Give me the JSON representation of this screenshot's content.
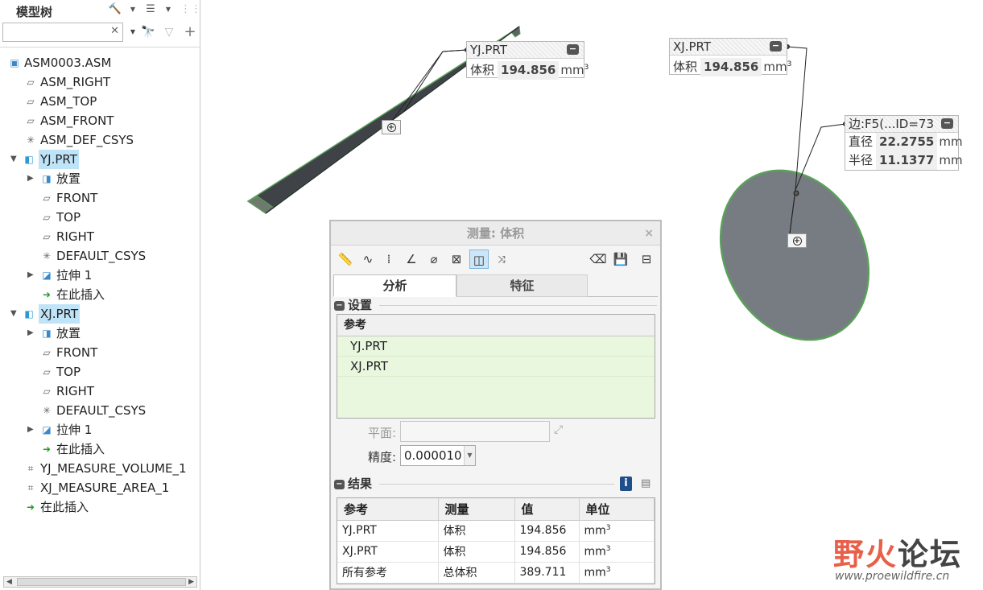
{
  "tree": {
    "title": "模型树",
    "search_value": "",
    "rows": [
      {
        "label": "ASM0003.ASM"
      },
      {
        "label": "ASM_RIGHT"
      },
      {
        "label": "ASM_TOP"
      },
      {
        "label": "ASM_FRONT"
      },
      {
        "label": "ASM_DEF_CSYS"
      },
      {
        "label": "YJ.PRT"
      },
      {
        "label": "放置"
      },
      {
        "label": "FRONT"
      },
      {
        "label": "TOP"
      },
      {
        "label": "RIGHT"
      },
      {
        "label": "DEFAULT_CSYS"
      },
      {
        "label": "拉伸 1"
      },
      {
        "label": "在此插入"
      },
      {
        "label": "XJ.PRT"
      },
      {
        "label": "放置"
      },
      {
        "label": "FRONT"
      },
      {
        "label": "TOP"
      },
      {
        "label": "RIGHT"
      },
      {
        "label": "DEFAULT_CSYS"
      },
      {
        "label": "拉伸 1"
      },
      {
        "label": "在此插入"
      },
      {
        "label": "YJ_MEASURE_VOLUME_1"
      },
      {
        "label": "XJ_MEASURE_AREA_1"
      },
      {
        "label": "在此插入"
      }
    ]
  },
  "callouts": {
    "yj": {
      "title": "YJ.PRT",
      "key": "体积",
      "value": "194.856",
      "unit": "mm",
      "unit_sup": "3"
    },
    "xj": {
      "title": "XJ.PRT",
      "key": "体积",
      "value": "194.856",
      "unit": "mm",
      "unit_sup": "3"
    },
    "edge": {
      "title": "边:F5(...ID=73",
      "rows": [
        {
          "key": "直径",
          "value": "22.2755",
          "unit": "mm"
        },
        {
          "key": "半径",
          "value": "11.1377",
          "unit": "mm"
        }
      ]
    }
  },
  "dialog": {
    "title": "测量: 体积",
    "close": "×",
    "tabs": [
      {
        "label": "分析"
      },
      {
        "label": "特征"
      }
    ],
    "settings_label": "设置",
    "ref_header": "参考",
    "refs": [
      "YJ.PRT",
      "XJ.PRT"
    ],
    "plane_label": "平面:",
    "plane_value": "",
    "precision_label": "精度:",
    "precision_value": "0.000010",
    "results_label": "结果",
    "results_headers": [
      "参考",
      "测量",
      "值",
      "单位"
    ],
    "results_rows": [
      {
        "ref": "YJ.PRT",
        "measure": "体积",
        "value": "194.856",
        "unit": "mm",
        "unit_sup": "3"
      },
      {
        "ref": "XJ.PRT",
        "measure": "体积",
        "value": "194.856",
        "unit": "mm",
        "unit_sup": "3"
      },
      {
        "ref": "所有参考",
        "measure": "总体积",
        "value": "389.711",
        "unit": "mm",
        "unit_sup": "3"
      }
    ]
  },
  "watermark": {
    "part1": "野火",
    "part2": "论坛",
    "url": "www.proewildfire.cn"
  },
  "colors": {
    "selection": "#bfe3f7",
    "part_face": "#777c82",
    "part_edge": "#5aa05a",
    "ref_bg": "#eaf7df"
  }
}
